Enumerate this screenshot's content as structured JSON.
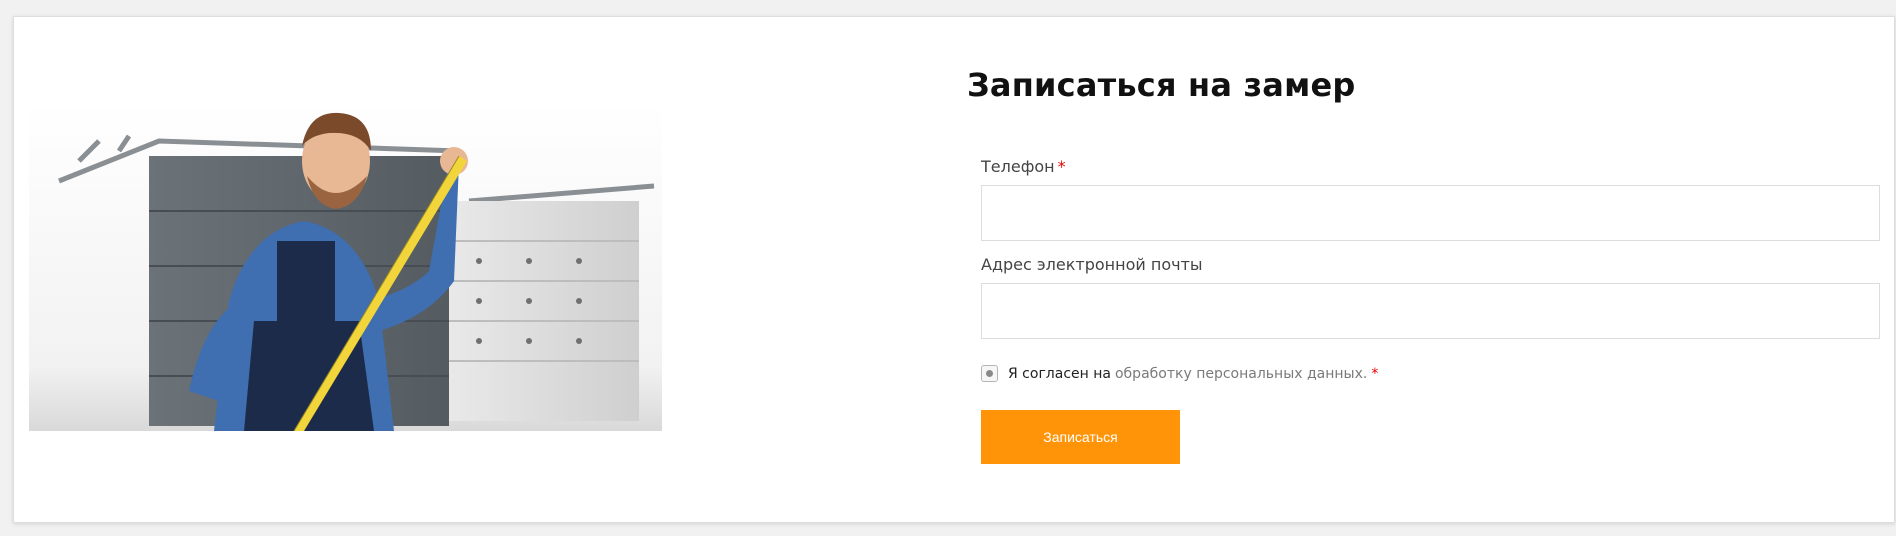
{
  "form": {
    "title": "Записаться на замер",
    "phone_label": "Телефон",
    "phone_value": "",
    "email_label": "Адрес электронной почты",
    "email_value": "",
    "required_mark": "*",
    "consent_text": "Я согласен на",
    "consent_link_text": "обработку персональных данных.",
    "submit_label": "Записаться"
  },
  "hero_image": {
    "icon": "worker-with-tape-measure-photo"
  },
  "colors": {
    "accent": "#ff9408",
    "required": "#e60000",
    "link": "#7a7a7a"
  }
}
